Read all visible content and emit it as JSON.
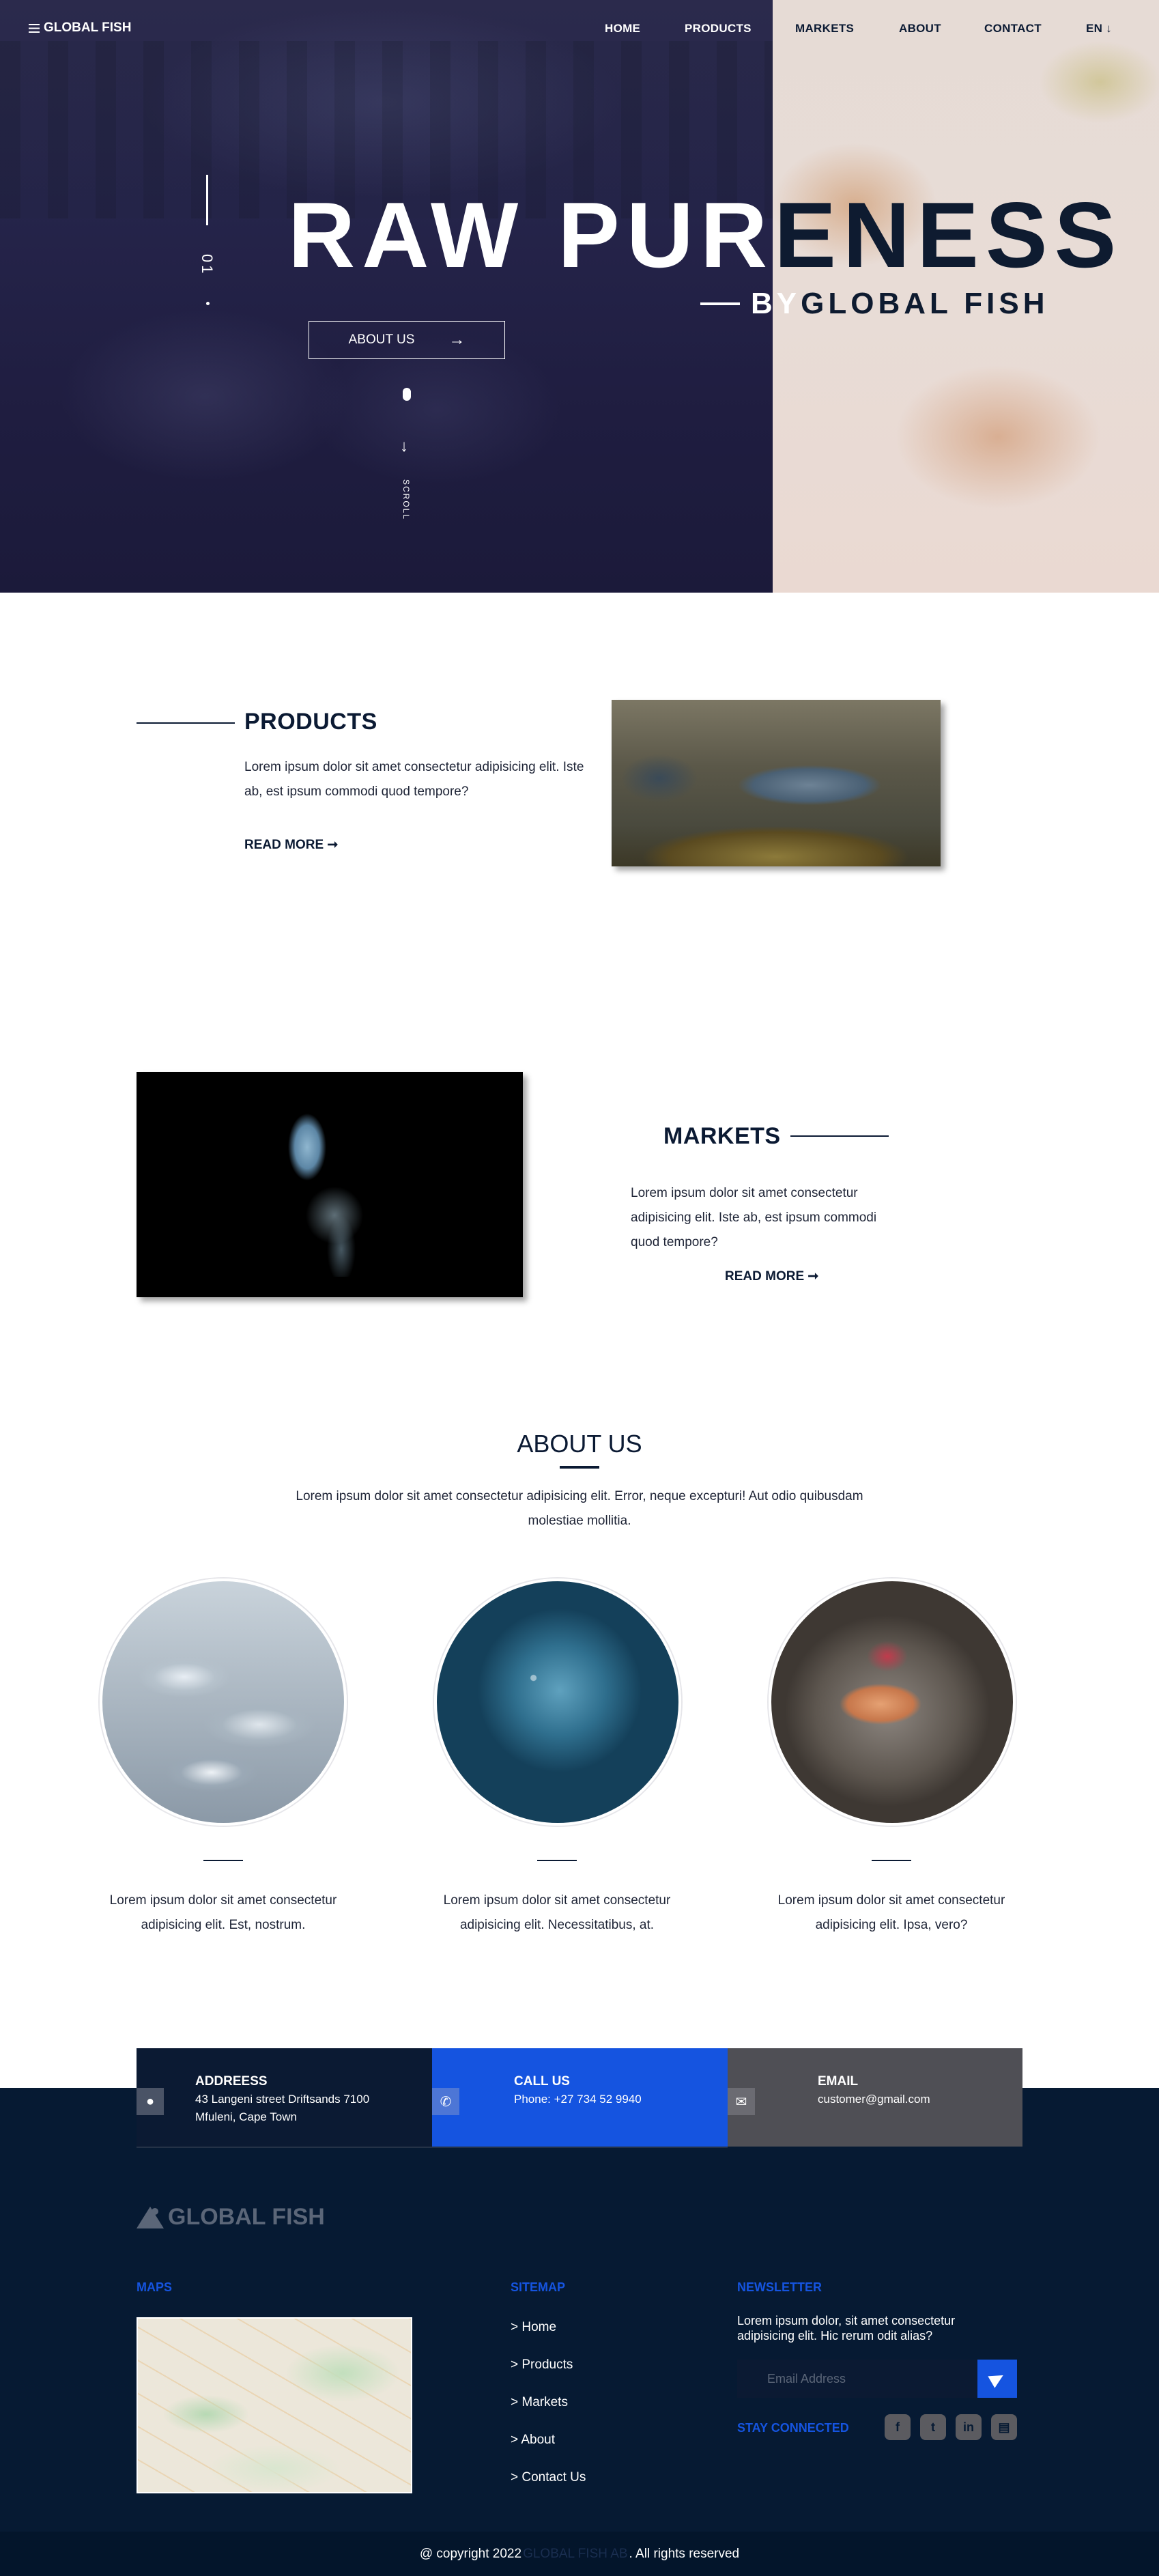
{
  "nav": {
    "brand": "GLOBAL FISH",
    "links": [
      "HOME",
      "PRODUCTS",
      "MARKETS",
      "ABOUT",
      "CONTACT"
    ],
    "lang": "EN",
    "lang_arrow": "↓"
  },
  "hero": {
    "title_light": "RAW PUR",
    "title_dark": "ENESS",
    "sub_light": "BY",
    "sub_dark": "GLOBAL FISH",
    "slide_number": "01",
    "about_button": "ABOUT US",
    "about_arrow": "→",
    "scroll_arrow": "↓",
    "scroll_label": "SCROLL"
  },
  "products": {
    "title": "PRODUCTS",
    "text": "Lorem ipsum dolor sit amet consectetur adipisicing elit. Iste ab, est ipsum commodi quod tempore?",
    "read_more": "READ MORE ➞"
  },
  "markets": {
    "title": "MARKETS",
    "text": "Lorem ipsum dolor sit amet consectetur adipisicing elit. Iste ab, est ipsum commodi quod tempore?",
    "read_more": "READ MORE ➞"
  },
  "about": {
    "title": "ABOUT US",
    "text": "Lorem ipsum dolor sit amet consectetur adipisicing elit. Error, neque excepturi! Aut odio quibusdam molestiae mollitia.",
    "cards": [
      {
        "text": "Lorem ipsum dolor sit amet consectetur adipisicing elit. Est, nostrum."
      },
      {
        "text": "Lorem ipsum dolor sit amet consectetur adipisicing elit. Necessitatibus, at."
      },
      {
        "text": "Lorem ipsum dolor sit amet consectetur adipisicing elit. Ipsa, vero?"
      }
    ]
  },
  "contact": {
    "address_label": "ADDREESS",
    "address_value": "43 Langeni street Driftsands 7100 Mfuleni, Cape Town",
    "call_label": "CALL US",
    "call_value": "Phone: +27 734 52 9940",
    "email_label": "EMAIL",
    "email_value": "customer@gmail.com",
    "icons": [
      "map-pin-icon",
      "phone-icon",
      "mail-icon"
    ]
  },
  "footer": {
    "brand": "GLOBAL FISH",
    "maps_heading": "MAPS",
    "sitemap_heading": "SITEMAP",
    "sitemap_links": [
      "> Home",
      "> Products",
      "> Markets",
      "> About",
      "> Contact Us"
    ],
    "newsletter_heading": "NEWSLETTER",
    "newsletter_text": "Lorem ipsum dolor, sit amet consectetur adipisicing elit. Hic rerum odit alias?",
    "email_placeholder": "Email Address",
    "stay_connected": "STAY CONNECTED",
    "social_icons": [
      "facebook-icon",
      "twitter-icon",
      "linkedin-icon",
      "contact-card-icon"
    ],
    "copyright_prefix": "@ copyright 2022",
    "copyright_brand": "GLOBAL FISH AB",
    "copyright_suffix": ". All rights reserved"
  },
  "colors": {
    "navy": "#061a33",
    "accent_blue": "#1554e0",
    "gray": "#4f4f55"
  }
}
